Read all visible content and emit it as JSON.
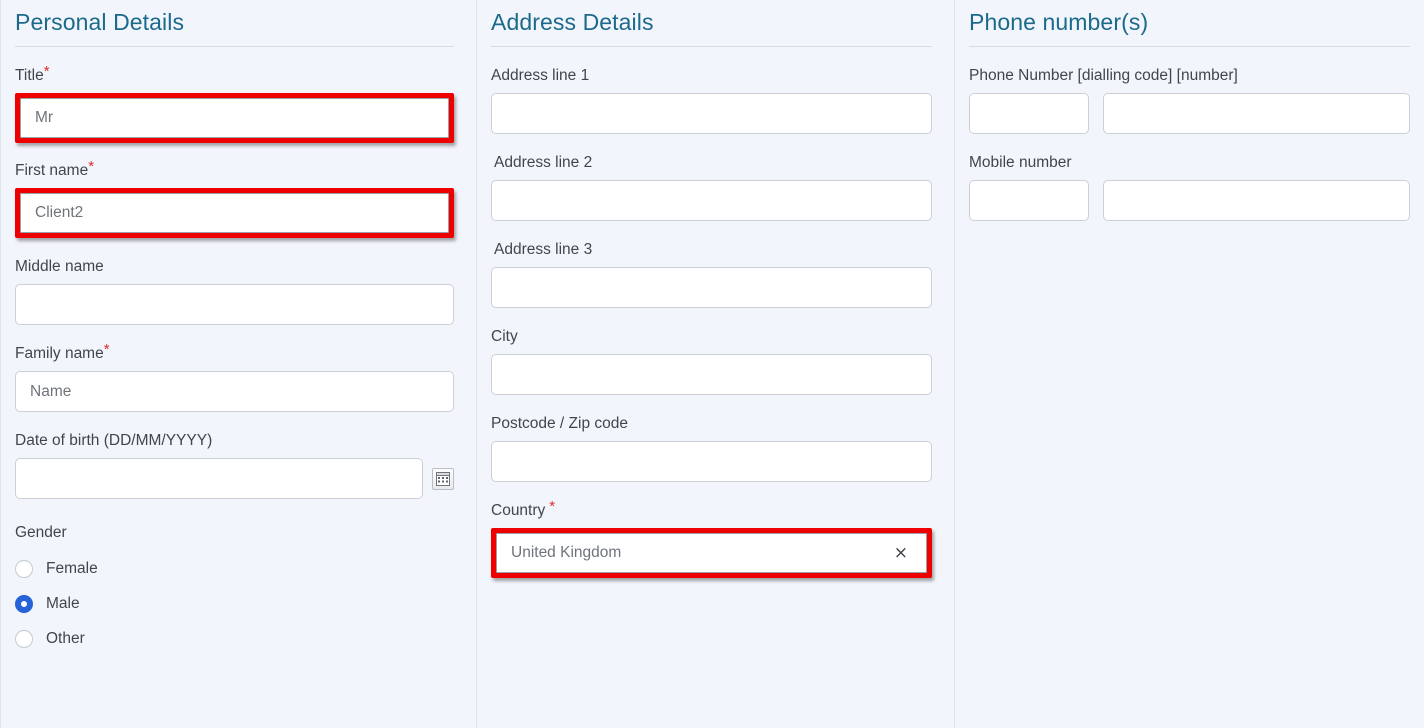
{
  "colors": {
    "heading": "#1b6a8b",
    "background": "#f2f5fb",
    "highlight": "#ee0000",
    "required_asterisk": "#e02b2b",
    "radio_selected": "#2563d6",
    "input_border": "#ccd0d6",
    "label_text": "#41464d",
    "value_text": "#6f747b"
  },
  "personal": {
    "heading": "Personal Details",
    "title": {
      "label": "Title",
      "required": "*",
      "value": "Mr",
      "highlighted": true
    },
    "first_name": {
      "label": "First name",
      "required": "*",
      "value": "Client2",
      "highlighted": true
    },
    "middle_name": {
      "label": "Middle name",
      "value": ""
    },
    "family_name": {
      "label": "Family name",
      "required": "*",
      "value": "Name"
    },
    "date_of_birth": {
      "label": "Date of birth (DD/MM/YYYY)",
      "value": "",
      "calendar_icon": "calendar-icon"
    },
    "gender": {
      "label": "Gender",
      "options": [
        {
          "label": "Female",
          "selected": false
        },
        {
          "label": "Male",
          "selected": true
        },
        {
          "label": "Other",
          "selected": false
        }
      ]
    }
  },
  "address": {
    "heading": "Address Details",
    "line1": {
      "label": "Address line 1",
      "value": ""
    },
    "line2": {
      "label": "Address line 2",
      "value": ""
    },
    "line3": {
      "label": "Address line 3",
      "value": ""
    },
    "city": {
      "label": "City",
      "value": ""
    },
    "postcode": {
      "label": "Postcode / Zip code",
      "value": ""
    },
    "country": {
      "label": "Country",
      "required": "*",
      "value": "United Kingdom",
      "clear_icon": "×",
      "highlighted": true
    }
  },
  "phone": {
    "heading": "Phone number(s)",
    "phone_number": {
      "label": "Phone Number [dialling code] [number]",
      "dialling_code": "",
      "number": ""
    },
    "mobile_number": {
      "label": "Mobile number",
      "dialling_code": "",
      "number": ""
    }
  }
}
